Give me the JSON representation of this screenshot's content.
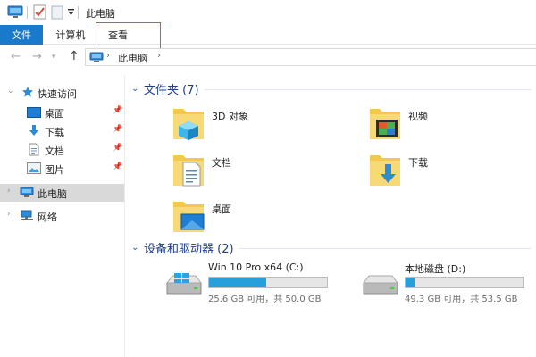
{
  "window": {
    "title": "此电脑"
  },
  "ribbon": {
    "tabs": [
      {
        "label": "文件",
        "active": true
      },
      {
        "label": "计算机"
      },
      {
        "label": "查看"
      }
    ]
  },
  "address": {
    "path": [
      "此电脑"
    ]
  },
  "nav": {
    "quick_access": "快速访问",
    "quick_items": [
      {
        "label": "桌面",
        "icon": "desktop-icon",
        "pinned": true
      },
      {
        "label": "下载",
        "icon": "download-icon",
        "pinned": true
      },
      {
        "label": "文档",
        "icon": "document-icon",
        "pinned": true
      },
      {
        "label": "图片",
        "icon": "picture-icon",
        "pinned": true
      }
    ],
    "this_pc": "此电脑",
    "network": "网络"
  },
  "folders": {
    "title": "文件夹 (7)",
    "items": [
      {
        "label": "3D 对象",
        "icon": "3d-objects-folder-icon"
      },
      {
        "label": "视频",
        "icon": "videos-folder-icon"
      },
      {
        "label": "文档",
        "icon": "documents-folder-icon"
      },
      {
        "label": "下载",
        "icon": "downloads-folder-icon"
      },
      {
        "label": "桌面",
        "icon": "desktop-folder-icon"
      }
    ]
  },
  "drives": {
    "title": "设备和驱动器 (2)",
    "items": [
      {
        "label": "Win 10 Pro x64 (C:)",
        "info": "25.6 GB 可用，共 50.0 GB",
        "used_fraction": 0.488,
        "icon": "windows-drive-icon"
      },
      {
        "label": "本地磁盘 (D:)",
        "info": "49.3 GB 可用，共 53.5 GB",
        "used_fraction": 0.078,
        "icon": "local-disk-icon"
      }
    ]
  },
  "colors": {
    "accent": "#1979ca",
    "group_title": "#1e3c8a",
    "bar_fill": "#26a0da",
    "highlight": "#e8474c"
  }
}
